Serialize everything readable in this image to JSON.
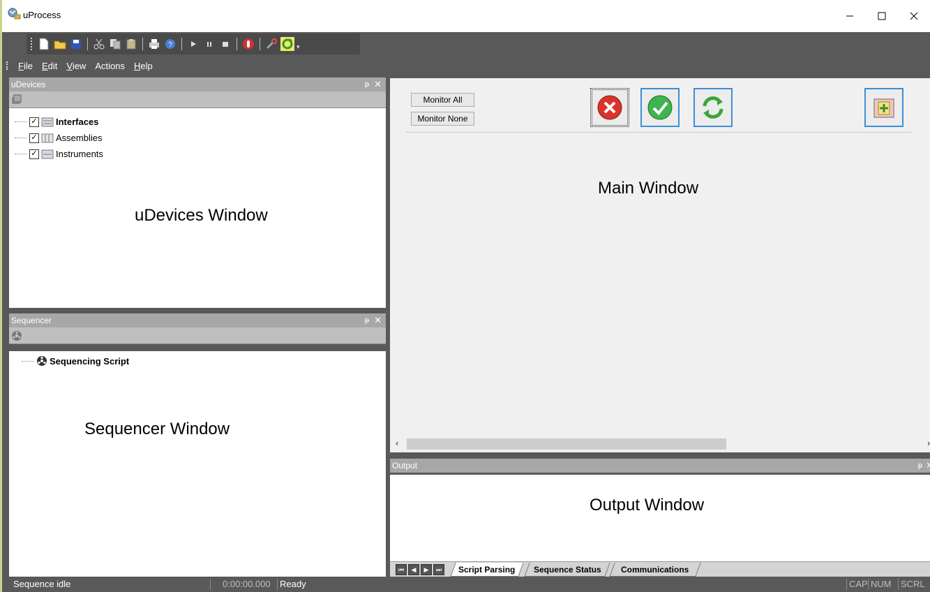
{
  "window": {
    "title": "uProcess"
  },
  "menu": [
    "File",
    "Edit",
    "View",
    "Actions",
    "Help"
  ],
  "menu_underline": [
    "F",
    "E",
    "V",
    "",
    "H"
  ],
  "toolbar_icons": [
    "new-file-icon",
    "open-folder-icon",
    "save-icon",
    "cut-icon",
    "copy-icon",
    "paste-icon",
    "print-icon",
    "help-icon",
    "run-icon",
    "pause-icon",
    "stop-icon",
    "record-icon",
    "tools-icon",
    "refresh-icon"
  ],
  "udevices": {
    "title": "uDevices",
    "items": [
      {
        "label": "Interfaces",
        "bold": true
      },
      {
        "label": "Assemblies",
        "bold": false
      },
      {
        "label": "Instruments",
        "bold": false
      }
    ],
    "caption": "uDevices Window"
  },
  "sequencer": {
    "title": "Sequencer",
    "root": "Sequencing Script",
    "caption": "Sequencer Window"
  },
  "main": {
    "monitor_all": "Monitor All",
    "monitor_none": "Monitor None",
    "caption": "Main Window"
  },
  "output": {
    "title": "Output",
    "caption": "Output Window",
    "tabs": [
      "Script Parsing",
      "Sequence Status",
      "Communications"
    ],
    "active_tab": "Script Parsing"
  },
  "status": {
    "state": "Sequence idle",
    "timer": "0:00:00.000",
    "message": "Ready",
    "indicators": [
      "CAP",
      "NUM",
      "SCRL"
    ]
  },
  "colors": {
    "chrome": "#595959",
    "panel_header": "#a7a7a7",
    "accent_blue": "#3b8ed8"
  }
}
